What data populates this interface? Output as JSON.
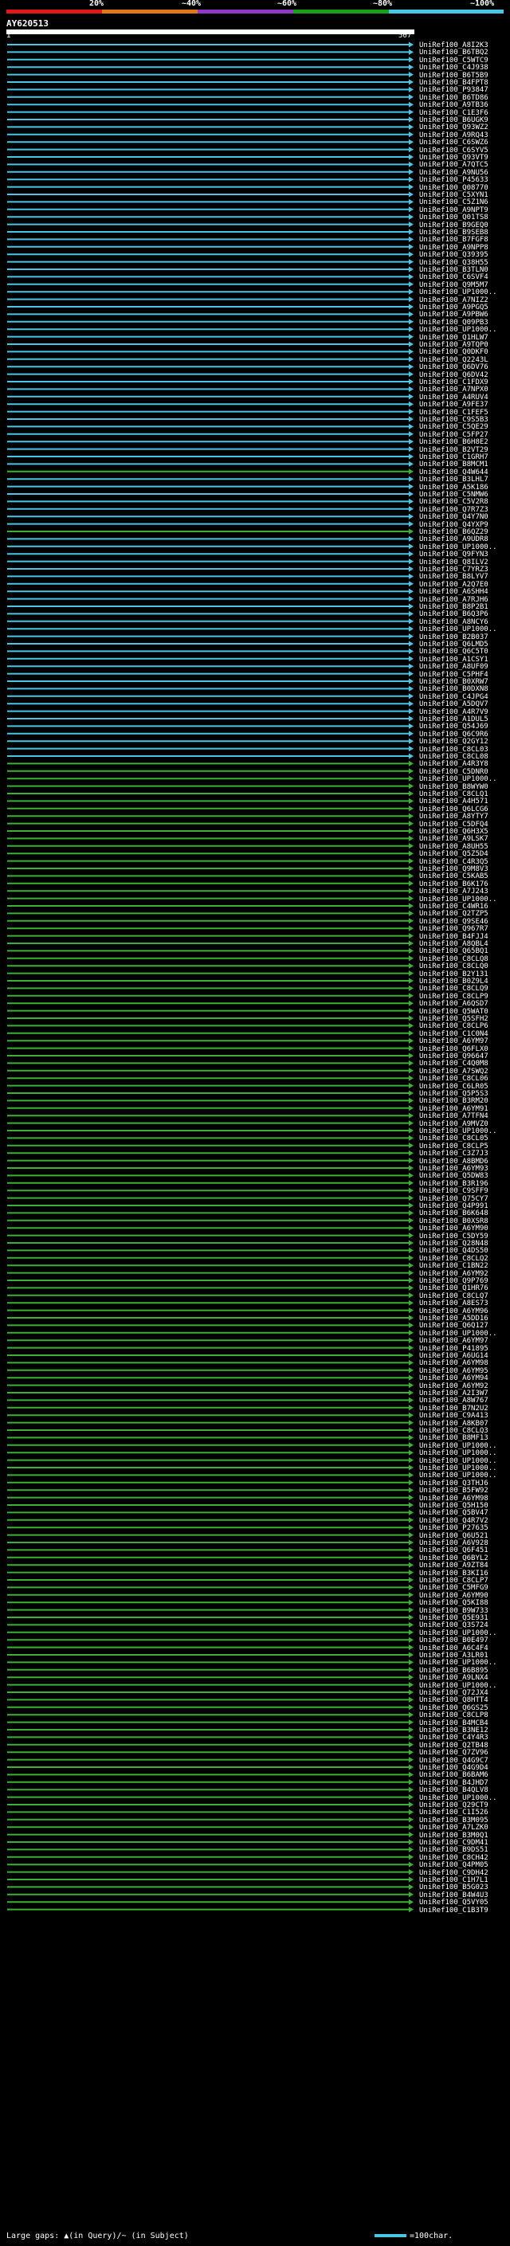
{
  "scale": {
    "labels": [
      "20%",
      "~40%",
      "~60%",
      "~80%",
      "~100%"
    ],
    "colors": [
      "#e0181a",
      "#e07818",
      "#9038c8",
      "#18a018",
      "#48c6e6"
    ]
  },
  "query": {
    "title": "AY620513",
    "start": "1",
    "end": "507"
  },
  "hits": [
    {
      "label": "UniRef100_A8I2K3",
      "pct": 100
    },
    {
      "label": "UniRef100_B6TBQ2",
      "pct": 100
    },
    {
      "label": "UniRef100_C5WTC9",
      "pct": 100
    },
    {
      "label": "UniRef100_C4J938",
      "pct": 100
    },
    {
      "label": "UniRef100_B6T5B9",
      "pct": 100
    },
    {
      "label": "UniRef100_B4FPT8",
      "pct": 100
    },
    {
      "label": "UniRef100_P93847",
      "pct": 100
    },
    {
      "label": "UniRef100_B6TD86",
      "pct": 100
    },
    {
      "label": "UniRef100_A9TB36",
      "pct": 100
    },
    {
      "label": "UniRef100_C1E3F6",
      "pct": 100
    },
    {
      "label": "UniRef100_B6UGK9",
      "pct": 100
    },
    {
      "label": "UniRef100_Q93WZ2",
      "pct": 100
    },
    {
      "label": "UniRef100_A9RQ43",
      "pct": 100
    },
    {
      "label": "UniRef100_C6SWZ6",
      "pct": 100
    },
    {
      "label": "UniRef100_C6SYV5",
      "pct": 100
    },
    {
      "label": "UniRef100_Q93VT9",
      "pct": 100
    },
    {
      "label": "UniRef100_A7QTC5",
      "pct": 100
    },
    {
      "label": "UniRef100_A9NU56",
      "pct": 100
    },
    {
      "label": "UniRef100_P45633",
      "pct": 100
    },
    {
      "label": "UniRef100_Q08770",
      "pct": 100
    },
    {
      "label": "UniRef100_C5XYN1",
      "pct": 100
    },
    {
      "label": "UniRef100_C5Z1N6",
      "pct": 100
    },
    {
      "label": "UniRef100_A9NPT9",
      "pct": 100
    },
    {
      "label": "UniRef100_Q01TS8",
      "pct": 100
    },
    {
      "label": "UniRef100_B9GEQ0",
      "pct": 100
    },
    {
      "label": "UniRef100_B9SEB8",
      "pct": 100
    },
    {
      "label": "UniRef100_B7FGF8",
      "pct": 100
    },
    {
      "label": "UniRef100_A9NPP8",
      "pct": 100
    },
    {
      "label": "UniRef100_Q39395",
      "pct": 100
    },
    {
      "label": "UniRef100_Q38H55",
      "pct": 100
    },
    {
      "label": "UniRef100_B3TLN0",
      "pct": 100
    },
    {
      "label": "UniRef100_C6SVF4",
      "pct": 100
    },
    {
      "label": "UniRef100_Q9M5M7",
      "pct": 100
    },
    {
      "label": "UniRef100_UP1000..",
      "pct": 100
    },
    {
      "label": "UniRef100_A7NIZ2",
      "pct": 100
    },
    {
      "label": "UniRef100_A9PGQ5",
      "pct": 100
    },
    {
      "label": "UniRef100_A9PBW6",
      "pct": 100
    },
    {
      "label": "UniRef100_Q09PB3",
      "pct": 100
    },
    {
      "label": "UniRef100_UP1000..",
      "pct": 100
    },
    {
      "label": "UniRef100_Q1HLW7",
      "pct": 100
    },
    {
      "label": "UniRef100_A9TQP0",
      "pct": 100
    },
    {
      "label": "UniRef100_Q0DKF0",
      "pct": 100
    },
    {
      "label": "UniRef100_Q2243L",
      "pct": 100
    },
    {
      "label": "UniRef100_Q6DV76",
      "pct": 100
    },
    {
      "label": "UniRef100_Q6DV42",
      "pct": 100
    },
    {
      "label": "UniRef100_C1FDX9",
      "pct": 100
    },
    {
      "label": "UniRef100_A7NPX0",
      "pct": 100
    },
    {
      "label": "UniRef100_A4RUV4",
      "pct": 100
    },
    {
      "label": "UniRef100_A9FE37",
      "pct": 100
    },
    {
      "label": "UniRef100_C1FEF5",
      "pct": 100
    },
    {
      "label": "UniRef100_C9S5B3",
      "pct": 100
    },
    {
      "label": "UniRef100_C5QE29",
      "pct": 100
    },
    {
      "label": "UniRef100_C5FP27",
      "pct": 100
    },
    {
      "label": "UniRef100_B6H8E2",
      "pct": 100
    },
    {
      "label": "UniRef100_B2VT29",
      "pct": 100
    },
    {
      "label": "UniRef100_C1GRH7",
      "pct": 100
    },
    {
      "label": "UniRef100_B8MCM1",
      "pct": 100
    },
    {
      "label": "UniRef100_Q4W644",
      "pct": 80
    },
    {
      "label": "UniRef100_B3LHL7",
      "pct": 100
    },
    {
      "label": "UniRef100_A5K186",
      "pct": 100
    },
    {
      "label": "UniRef100_C5NMW6",
      "pct": 100
    },
    {
      "label": "UniRef100_C5V2R8",
      "pct": 100
    },
    {
      "label": "UniRef100_Q7R7Z3",
      "pct": 100
    },
    {
      "label": "UniRef100_Q4Y7N0",
      "pct": 100
    },
    {
      "label": "UniRef100_Q4YXP9",
      "pct": 100
    },
    {
      "label": "UniRef100_B6QZ29",
      "pct": 80
    },
    {
      "label": "UniRef100_A9UDR8",
      "pct": 100
    },
    {
      "label": "UniRef100_UP1000..",
      "pct": 100
    },
    {
      "label": "UniRef100_Q9FYN3",
      "pct": 100
    },
    {
      "label": "UniRef100_Q8ILV2",
      "pct": 100
    },
    {
      "label": "UniRef100_C7YRZ3",
      "pct": 100
    },
    {
      "label": "UniRef100_B8LYV7",
      "pct": 100
    },
    {
      "label": "UniRef100_A2Q7E0",
      "pct": 100
    },
    {
      "label": "UniRef100_A6SHH4",
      "pct": 100
    },
    {
      "label": "UniRef100_A7RJH6",
      "pct": 100
    },
    {
      "label": "UniRef100_B8P2B1",
      "pct": 100
    },
    {
      "label": "UniRef100_B6Q3P6",
      "pct": 100
    },
    {
      "label": "UniRef100_A8NCY6",
      "pct": 100
    },
    {
      "label": "UniRef100_UP1000..",
      "pct": 100
    },
    {
      "label": "UniRef100_B2B037",
      "pct": 100
    },
    {
      "label": "UniRef100_Q6LMD5",
      "pct": 100
    },
    {
      "label": "UniRef100_Q6C5T0",
      "pct": 100
    },
    {
      "label": "UniRef100_A1CSY1",
      "pct": 100
    },
    {
      "label": "UniRef100_A8UF09",
      "pct": 100
    },
    {
      "label": "UniRef100_C5PHF4",
      "pct": 100
    },
    {
      "label": "UniRef100_B0XRW7",
      "pct": 100
    },
    {
      "label": "UniRef100_B0DXN8",
      "pct": 100
    },
    {
      "label": "UniRef100_C4JPG4",
      "pct": 100
    },
    {
      "label": "UniRef100_A5DQV7",
      "pct": 100
    },
    {
      "label": "UniRef100_A4R7V9",
      "pct": 100
    },
    {
      "label": "UniRef100_A1DUL5",
      "pct": 100
    },
    {
      "label": "UniRef100_Q54J69",
      "pct": 100
    },
    {
      "label": "UniRef100_Q6C9R6",
      "pct": 100
    },
    {
      "label": "UniRef100_Q2GY12",
      "pct": 100
    },
    {
      "label": "UniRef100_C8CL03",
      "pct": 100
    },
    {
      "label": "UniRef100_C8CL08",
      "pct": 100
    },
    {
      "label": "UniRef100_A4R3Y8",
      "pct": 80
    },
    {
      "label": "UniRef100_C5DNR0",
      "pct": 80
    },
    {
      "label": "UniRef100_UP1000..",
      "pct": 80
    },
    {
      "label": "UniRef100_B8WYW0",
      "pct": 80
    },
    {
      "label": "UniRef100_C8CLQ1",
      "pct": 80
    },
    {
      "label": "UniRef100_A4H571",
      "pct": 80
    },
    {
      "label": "UniRef100_Q6LCG6",
      "pct": 80
    },
    {
      "label": "UniRef100_A8YTY7",
      "pct": 80
    },
    {
      "label": "UniRef100_C5DFQ4",
      "pct": 80
    },
    {
      "label": "UniRef100_Q6H3X5",
      "pct": 80
    },
    {
      "label": "UniRef100_A9LSK7",
      "pct": 80
    },
    {
      "label": "UniRef100_A8UH55",
      "pct": 80
    },
    {
      "label": "UniRef100_Q5Z5D4",
      "pct": 80
    },
    {
      "label": "UniRef100_C4R3Q5",
      "pct": 80
    },
    {
      "label": "UniRef100_Q9M8V3",
      "pct": 80
    },
    {
      "label": "UniRef100_C5KAB5",
      "pct": 80
    },
    {
      "label": "UniRef100_B6K176",
      "pct": 80
    },
    {
      "label": "UniRef100_A7J243",
      "pct": 80
    },
    {
      "label": "UniRef100_UP1000..",
      "pct": 80
    },
    {
      "label": "UniRef100_C4WR16",
      "pct": 80
    },
    {
      "label": "UniRef100_Q2TZP5",
      "pct": 80
    },
    {
      "label": "UniRef100_Q9SE46",
      "pct": 80
    },
    {
      "label": "UniRef100_Q967R7",
      "pct": 80
    },
    {
      "label": "UniRef100_B4FJJ4",
      "pct": 80
    },
    {
      "label": "UniRef100_A8QBL4",
      "pct": 80
    },
    {
      "label": "UniRef100_Q65BQ1",
      "pct": 80
    },
    {
      "label": "UniRef100_C8CLQ8",
      "pct": 80
    },
    {
      "label": "UniRef100_C8CLQ0",
      "pct": 80
    },
    {
      "label": "UniRef100_B2Y131",
      "pct": 80
    },
    {
      "label": "UniRef100_B0Z9L4",
      "pct": 80
    },
    {
      "label": "UniRef100_C8CLQ9",
      "pct": 80
    },
    {
      "label": "UniRef100_C8CLP9",
      "pct": 80
    },
    {
      "label": "UniRef100_A6QSD7",
      "pct": 80
    },
    {
      "label": "UniRef100_Q5WAT0",
      "pct": 80
    },
    {
      "label": "UniRef100_Q5SFH2",
      "pct": 80
    },
    {
      "label": "UniRef100_C8CLP6",
      "pct": 80
    },
    {
      "label": "UniRef100_C1C0N4",
      "pct": 80
    },
    {
      "label": "UniRef100_A6YM97",
      "pct": 80
    },
    {
      "label": "UniRef100_Q6FLX0",
      "pct": 80
    },
    {
      "label": "UniRef100_Q96647",
      "pct": 80
    },
    {
      "label": "UniRef100_C4Q0M8",
      "pct": 80
    },
    {
      "label": "UniRef100_A7SWQ2",
      "pct": 80
    },
    {
      "label": "UniRef100_C8CL06",
      "pct": 80
    },
    {
      "label": "UniRef100_C6LR05",
      "pct": 80
    },
    {
      "label": "UniRef100_Q5P5S3",
      "pct": 80
    },
    {
      "label": "UniRef100_B3RM20",
      "pct": 80
    },
    {
      "label": "UniRef100_A6YM91",
      "pct": 80
    },
    {
      "label": "UniRef100_A7TFN4",
      "pct": 80
    },
    {
      "label": "UniRef100_A9MVZ0",
      "pct": 80
    },
    {
      "label": "UniRef100_UP1000..",
      "pct": 80
    },
    {
      "label": "UniRef100_C8CL05",
      "pct": 80
    },
    {
      "label": "UniRef100_C8CLP5",
      "pct": 80
    },
    {
      "label": "UniRef100_C3Z7J3",
      "pct": 80
    },
    {
      "label": "UniRef100_A8BMD6",
      "pct": 80
    },
    {
      "label": "UniRef100_A6YM93",
      "pct": 80
    },
    {
      "label": "UniRef100_Q5DW83",
      "pct": 80
    },
    {
      "label": "UniRef100_B3R196",
      "pct": 80
    },
    {
      "label": "UniRef100_C9SFF9",
      "pct": 80
    },
    {
      "label": "UniRef100_Q75CY7",
      "pct": 80
    },
    {
      "label": "UniRef100_Q4P991",
      "pct": 80
    },
    {
      "label": "UniRef100_B6K648",
      "pct": 80
    },
    {
      "label": "UniRef100_B0XSR8",
      "pct": 80
    },
    {
      "label": "UniRef100_A6YM90",
      "pct": 80
    },
    {
      "label": "UniRef100_C5DY59",
      "pct": 80
    },
    {
      "label": "UniRef100_Q28N48",
      "pct": 80
    },
    {
      "label": "UniRef100_Q4DS50",
      "pct": 80
    },
    {
      "label": "UniRef100_C8CLQ2",
      "pct": 80
    },
    {
      "label": "UniRef100_C1BN22",
      "pct": 80
    },
    {
      "label": "UniRef100_A6YM92",
      "pct": 80
    },
    {
      "label": "UniRef100_Q9P769",
      "pct": 80
    },
    {
      "label": "UniRef100_Q1HR76",
      "pct": 80
    },
    {
      "label": "UniRef100_C8CLQ7",
      "pct": 80
    },
    {
      "label": "UniRef100_A8ES73",
      "pct": 80
    },
    {
      "label": "UniRef100_A6YM96",
      "pct": 80
    },
    {
      "label": "UniRef100_A5DD16",
      "pct": 80
    },
    {
      "label": "UniRef100_Q6Q127",
      "pct": 80
    },
    {
      "label": "UniRef100_UP1000..",
      "pct": 80
    },
    {
      "label": "UniRef100_A6YM97",
      "pct": 80
    },
    {
      "label": "UniRef100_P41895",
      "pct": 80
    },
    {
      "label": "UniRef100_A6UG14",
      "pct": 80
    },
    {
      "label": "UniRef100_A6YM98",
      "pct": 80
    },
    {
      "label": "UniRef100_A6YM95",
      "pct": 80
    },
    {
      "label": "UniRef100_A6YM94",
      "pct": 80
    },
    {
      "label": "UniRef100_A6YM92",
      "pct": 80
    },
    {
      "label": "UniRef100_A2I3W7",
      "pct": 80
    },
    {
      "label": "UniRef100_A8W767",
      "pct": 80
    },
    {
      "label": "UniRef100_B7N2U2",
      "pct": 80
    },
    {
      "label": "UniRef100_C9A413",
      "pct": 80
    },
    {
      "label": "UniRef100_A8KB07",
      "pct": 80
    },
    {
      "label": "UniRef100_C8CLQ3",
      "pct": 80
    },
    {
      "label": "UniRef100_B8MF13",
      "pct": 80
    },
    {
      "label": "UniRef100_UP1000..",
      "pct": 80
    },
    {
      "label": "UniRef100_UP1000..",
      "pct": 80
    },
    {
      "label": "UniRef100_UP1000..",
      "pct": 80
    },
    {
      "label": "UniRef100_UP1000..",
      "pct": 80
    },
    {
      "label": "UniRef100_UP1000..",
      "pct": 80
    },
    {
      "label": "UniRef100_Q3THJ6",
      "pct": 80
    },
    {
      "label": "UniRef100_B5FW92",
      "pct": 80
    },
    {
      "label": "UniRef100_A6YM98",
      "pct": 80
    },
    {
      "label": "UniRef100_Q5H150",
      "pct": 80
    },
    {
      "label": "UniRef100_Q5BV47",
      "pct": 80
    },
    {
      "label": "UniRef100_Q4R7V2",
      "pct": 80
    },
    {
      "label": "UniRef100_P27635",
      "pct": 80
    },
    {
      "label": "UniRef100_Q6U521",
      "pct": 80
    },
    {
      "label": "UniRef100_A6V928",
      "pct": 80
    },
    {
      "label": "UniRef100_Q6F451",
      "pct": 80
    },
    {
      "label": "UniRef100_Q6BYL2",
      "pct": 80
    },
    {
      "label": "UniRef100_A9ZT84",
      "pct": 80
    },
    {
      "label": "UniRef100_B3KI16",
      "pct": 80
    },
    {
      "label": "UniRef100_C8CLP7",
      "pct": 80
    },
    {
      "label": "UniRef100_C5MFG9",
      "pct": 80
    },
    {
      "label": "UniRef100_A6YM90",
      "pct": 80
    },
    {
      "label": "UniRef100_Q5KI88",
      "pct": 80
    },
    {
      "label": "UniRef100_B9W733",
      "pct": 80
    },
    {
      "label": "UniRef100_Q5E931",
      "pct": 80
    },
    {
      "label": "UniRef100_Q3S724",
      "pct": 80
    },
    {
      "label": "UniRef100_UP1000..",
      "pct": 80
    },
    {
      "label": "UniRef100_B0E497",
      "pct": 80
    },
    {
      "label": "UniRef100_A6C4F4",
      "pct": 80
    },
    {
      "label": "UniRef100_A3LR01",
      "pct": 80
    },
    {
      "label": "UniRef100_UP1000..",
      "pct": 80
    },
    {
      "label": "UniRef100_B6B895",
      "pct": 80
    },
    {
      "label": "UniRef100_A9LNX4",
      "pct": 80
    },
    {
      "label": "UniRef100_UP1000..",
      "pct": 80
    },
    {
      "label": "UniRef100_Q72JX4",
      "pct": 80
    },
    {
      "label": "UniRef100_Q8HTT4",
      "pct": 80
    },
    {
      "label": "UniRef100_Q6GS25",
      "pct": 80
    },
    {
      "label": "UniRef100_C8CLP8",
      "pct": 80
    },
    {
      "label": "UniRef100_B4MCB4",
      "pct": 80
    },
    {
      "label": "UniRef100_B3NE12",
      "pct": 80
    },
    {
      "label": "UniRef100_C4Y4R3",
      "pct": 80
    },
    {
      "label": "UniRef100_Q2TB48",
      "pct": 80
    },
    {
      "label": "UniRef100_Q7ZV96",
      "pct": 80
    },
    {
      "label": "UniRef100_Q4G9C7",
      "pct": 80
    },
    {
      "label": "UniRef100_Q4G9D4",
      "pct": 80
    },
    {
      "label": "UniRef100_B6BAM6",
      "pct": 80
    },
    {
      "label": "UniRef100_B4JHD7",
      "pct": 80
    },
    {
      "label": "UniRef100_B4QLV8",
      "pct": 80
    },
    {
      "label": "UniRef100_UP1000..",
      "pct": 80
    },
    {
      "label": "UniRef100_Q29CT9",
      "pct": 80
    },
    {
      "label": "UniRef100_C1I526",
      "pct": 80
    },
    {
      "label": "UniRef100_B3M095",
      "pct": 80
    },
    {
      "label": "UniRef100_A7LZK0",
      "pct": 80
    },
    {
      "label": "UniRef100_B3M0Q1",
      "pct": 80
    },
    {
      "label": "UniRef100_C9DM41",
      "pct": 80
    },
    {
      "label": "UniRef100_B9DS51",
      "pct": 80
    },
    {
      "label": "UniRef100_C8CH42",
      "pct": 80
    },
    {
      "label": "UniRef100_Q4PM05",
      "pct": 80
    },
    {
      "label": "UniRef100_C9DH42",
      "pct": 80
    },
    {
      "label": "UniRef100_C1H7L1",
      "pct": 80
    },
    {
      "label": "UniRef100_B5G023",
      "pct": 80
    },
    {
      "label": "UniRef100_B4W4U3",
      "pct": 80
    },
    {
      "label": "UniRef100_Q5VY05",
      "pct": 80
    },
    {
      "label": "UniRef100_C1B3T9",
      "pct": 80
    }
  ],
  "legend": {
    "gaps_text": "Large gaps: ▲(in Query)/~ (in Subject)",
    "scale_text": "=100char."
  },
  "colors": {
    "high": "#48c6e6",
    "mid": "#3cb034",
    "background": "#000000"
  }
}
